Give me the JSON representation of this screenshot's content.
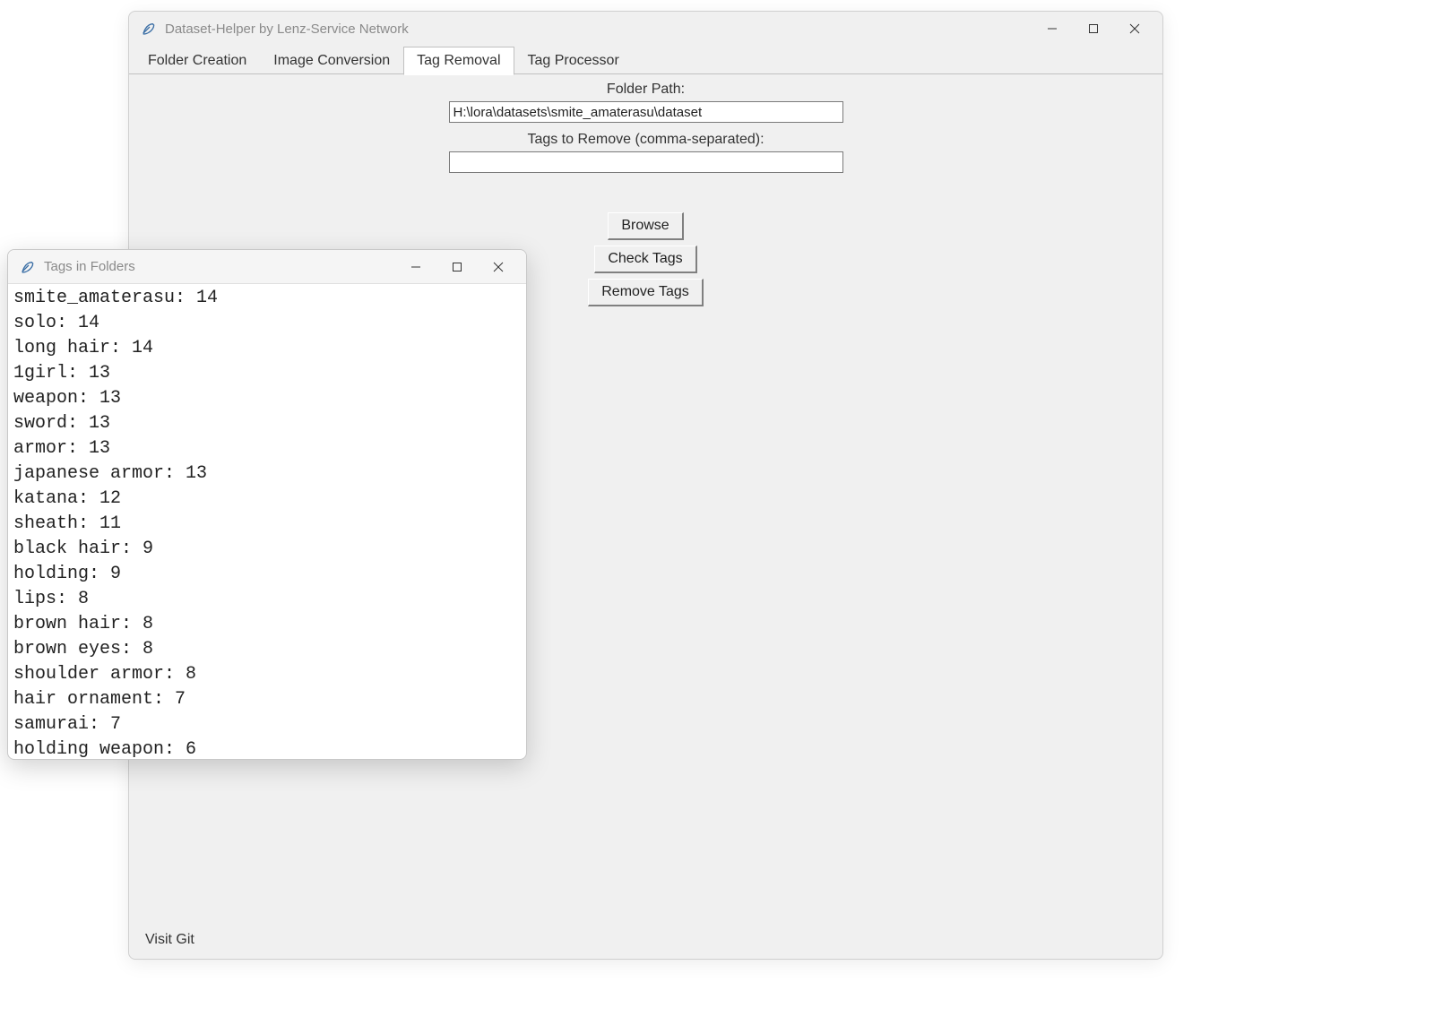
{
  "main_window": {
    "title": "Dataset-Helper by Lenz-Service Network",
    "tabs": [
      {
        "label": "Folder Creation",
        "active": false
      },
      {
        "label": "Image Conversion",
        "active": false
      },
      {
        "label": "Tag Removal",
        "active": true
      },
      {
        "label": "Tag Processor",
        "active": false
      }
    ],
    "folder_path_label": "Folder Path:",
    "folder_path_value": "H:\\lora\\datasets\\smite_amaterasu\\dataset",
    "tags_remove_label": "Tags to Remove (comma-separated):",
    "tags_remove_value": "",
    "buttons": {
      "browse": "Browse",
      "check_tags": "Check Tags",
      "remove_tags": "Remove Tags"
    },
    "status_link": "Visit Git"
  },
  "sub_window": {
    "title": "Tags in Folders",
    "tags": [
      {
        "name": "smite_amaterasu",
        "count": 14
      },
      {
        "name": "solo",
        "count": 14
      },
      {
        "name": "long hair",
        "count": 14
      },
      {
        "name": "1girl",
        "count": 13
      },
      {
        "name": "weapon",
        "count": 13
      },
      {
        "name": "sword",
        "count": 13
      },
      {
        "name": "armor",
        "count": 13
      },
      {
        "name": "japanese armor",
        "count": 13
      },
      {
        "name": "katana",
        "count": 12
      },
      {
        "name": "sheath",
        "count": 11
      },
      {
        "name": "black hair",
        "count": 9
      },
      {
        "name": "holding",
        "count": 9
      },
      {
        "name": "lips",
        "count": 8
      },
      {
        "name": "brown hair",
        "count": 8
      },
      {
        "name": "brown eyes",
        "count": 8
      },
      {
        "name": "shoulder armor",
        "count": 8
      },
      {
        "name": "hair ornament",
        "count": 7
      },
      {
        "name": "samurai",
        "count": 7
      },
      {
        "name": "holding weapon",
        "count": 6
      }
    ]
  },
  "icons": {
    "feather": "feather-icon",
    "minimize": "minimize-icon",
    "maximize": "maximize-icon",
    "close": "close-icon"
  }
}
